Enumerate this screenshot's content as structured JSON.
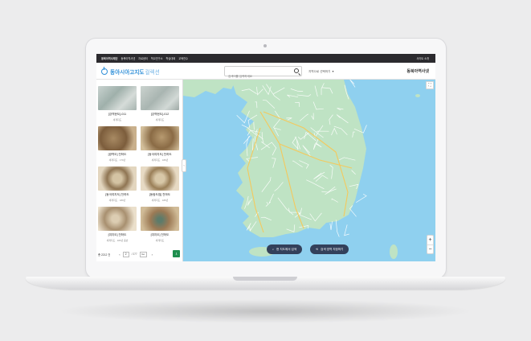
{
  "topbar": {
    "nav": [
      "동북아역사재단",
      "동북아역사넷",
      "자료센터",
      "학교연구소",
      "학술대회",
      "교육연수"
    ],
    "sitemap": "사이트 소개"
  },
  "header": {
    "logo_main": "동아시아고지도",
    "logo_sub": "컬렉션",
    "search_placeholder": "검색어를 입력하세요",
    "region_select": "지역으로 선택하기",
    "brand_right": "동북아역사넷"
  },
  "sidebar": {
    "cards": [
      {
        "title": "[강역현도]-011",
        "meta": "세계지도"
      },
      {
        "title": "[강역현도]-012",
        "meta": "세계지도"
      },
      {
        "title": "[광역도] 천하도",
        "meta": "세계지도 · 170년"
      },
      {
        "title": "[동국여지도] 천하도",
        "meta": "세계지도 · 180년"
      },
      {
        "title": "[동국여지도] 천하도",
        "meta": "세계지도 · 180년"
      },
      {
        "title": "[동람도첩] 천하도",
        "meta": "세계지도 · 180년"
      },
      {
        "title": "[여지도] 천하도",
        "meta": "세계지도 · 180년 중반"
      },
      {
        "title": "[여지도] 천하도",
        "meta": "세계지도"
      }
    ],
    "toggle": "‹"
  },
  "pager": {
    "total": "총 2212 건",
    "current": "2",
    "total_pages": "/ 277",
    "go": "Go",
    "prev": "‹",
    "next": "›",
    "download": "⇩"
  },
  "map": {
    "zoom_in": "+",
    "zoom_out": "−",
    "fullscreen": "⛶",
    "btn_map_search": "현 지도에서 검색",
    "btn_area_compare": "검색 영역 지정하기",
    "btn_map_search_icon": "⌕",
    "btn_area_compare_icon": "⟲",
    "colors": {
      "sea": "#8fd0ef",
      "land": "#bfe3c4",
      "road": "#ffffff",
      "highway": "#f4c95d"
    }
  }
}
